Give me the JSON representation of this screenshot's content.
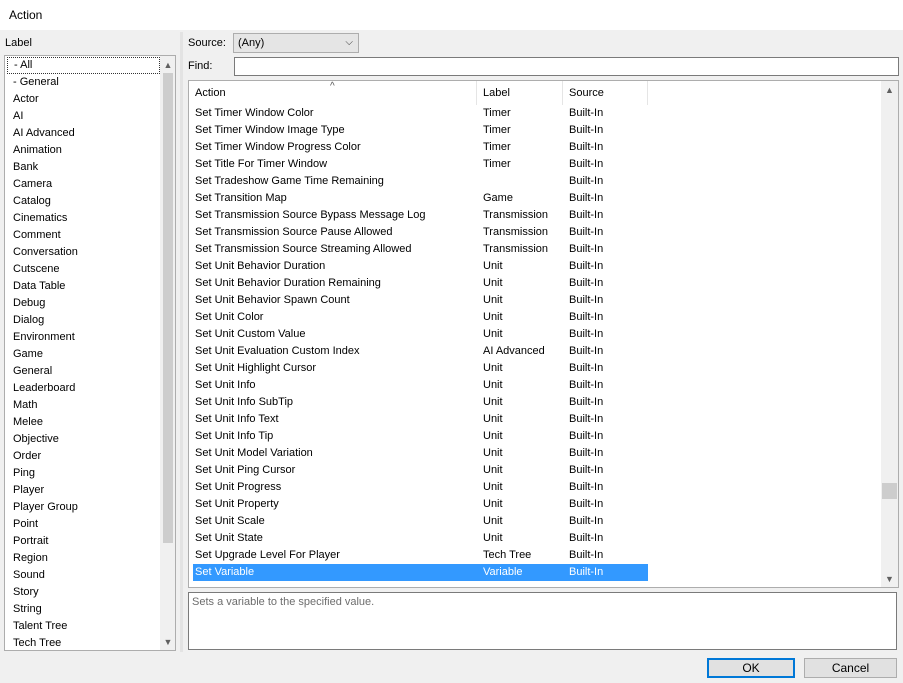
{
  "window": {
    "title": "Action"
  },
  "left_pane": {
    "header": "Label",
    "items": [
      "- All",
      "- General",
      "Actor",
      "AI",
      "AI Advanced",
      "Animation",
      "Bank",
      "Camera",
      "Catalog",
      "Cinematics",
      "Comment",
      "Conversation",
      "Cutscene",
      "Data Table",
      "Debug",
      "Dialog",
      "Environment",
      "Game",
      "General",
      "Leaderboard",
      "Math",
      "Melee",
      "Objective",
      "Order",
      "Ping",
      "Player",
      "Player Group",
      "Point",
      "Portrait",
      "Region",
      "Sound",
      "Story",
      "String",
      "Talent Tree",
      "Tech Tree"
    ],
    "selected_index": 0
  },
  "source": {
    "label": "Source:",
    "value": "(Any)"
  },
  "find": {
    "label": "Find:",
    "value": ""
  },
  "table": {
    "columns": [
      "Action",
      "Label",
      "Source"
    ],
    "rows": [
      [
        "Set Timer Window Color",
        "Timer",
        "Built-In"
      ],
      [
        "Set Timer Window Image Type",
        "Timer",
        "Built-In"
      ],
      [
        "Set Timer Window Progress Color",
        "Timer",
        "Built-In"
      ],
      [
        "Set Title For Timer Window",
        "Timer",
        "Built-In"
      ],
      [
        "Set Tradeshow Game Time Remaining",
        "",
        "Built-In"
      ],
      [
        "Set Transition Map",
        "Game",
        "Built-In"
      ],
      [
        "Set Transmission Source Bypass Message Log",
        "Transmission",
        "Built-In"
      ],
      [
        "Set Transmission Source Pause Allowed",
        "Transmission",
        "Built-In"
      ],
      [
        "Set Transmission Source Streaming Allowed",
        "Transmission",
        "Built-In"
      ],
      [
        "Set Unit Behavior Duration",
        "Unit",
        "Built-In"
      ],
      [
        "Set Unit Behavior Duration Remaining",
        "Unit",
        "Built-In"
      ],
      [
        "Set Unit Behavior Spawn Count",
        "Unit",
        "Built-In"
      ],
      [
        "Set Unit Color",
        "Unit",
        "Built-In"
      ],
      [
        "Set Unit Custom Value",
        "Unit",
        "Built-In"
      ],
      [
        "Set Unit Evaluation Custom Index",
        "AI Advanced",
        "Built-In"
      ],
      [
        "Set Unit Highlight Cursor",
        "Unit",
        "Built-In"
      ],
      [
        "Set Unit Info",
        "Unit",
        "Built-In"
      ],
      [
        "Set Unit Info SubTip",
        "Unit",
        "Built-In"
      ],
      [
        "Set Unit Info Text",
        "Unit",
        "Built-In"
      ],
      [
        "Set Unit Info Tip",
        "Unit",
        "Built-In"
      ],
      [
        "Set Unit Model Variation",
        "Unit",
        "Built-In"
      ],
      [
        "Set Unit Ping Cursor",
        "Unit",
        "Built-In"
      ],
      [
        "Set Unit Progress",
        "Unit",
        "Built-In"
      ],
      [
        "Set Unit Property",
        "Unit",
        "Built-In"
      ],
      [
        "Set Unit Scale",
        "Unit",
        "Built-In"
      ],
      [
        "Set Unit State",
        "Unit",
        "Built-In"
      ],
      [
        "Set Upgrade Level For Player",
        "Tech Tree",
        "Built-In"
      ],
      [
        "Set Variable",
        "Variable",
        "Built-In"
      ]
    ],
    "selected_index": 27
  },
  "description": "Sets a variable to the specified value.",
  "buttons": {
    "ok": "OK",
    "cancel": "Cancel"
  }
}
